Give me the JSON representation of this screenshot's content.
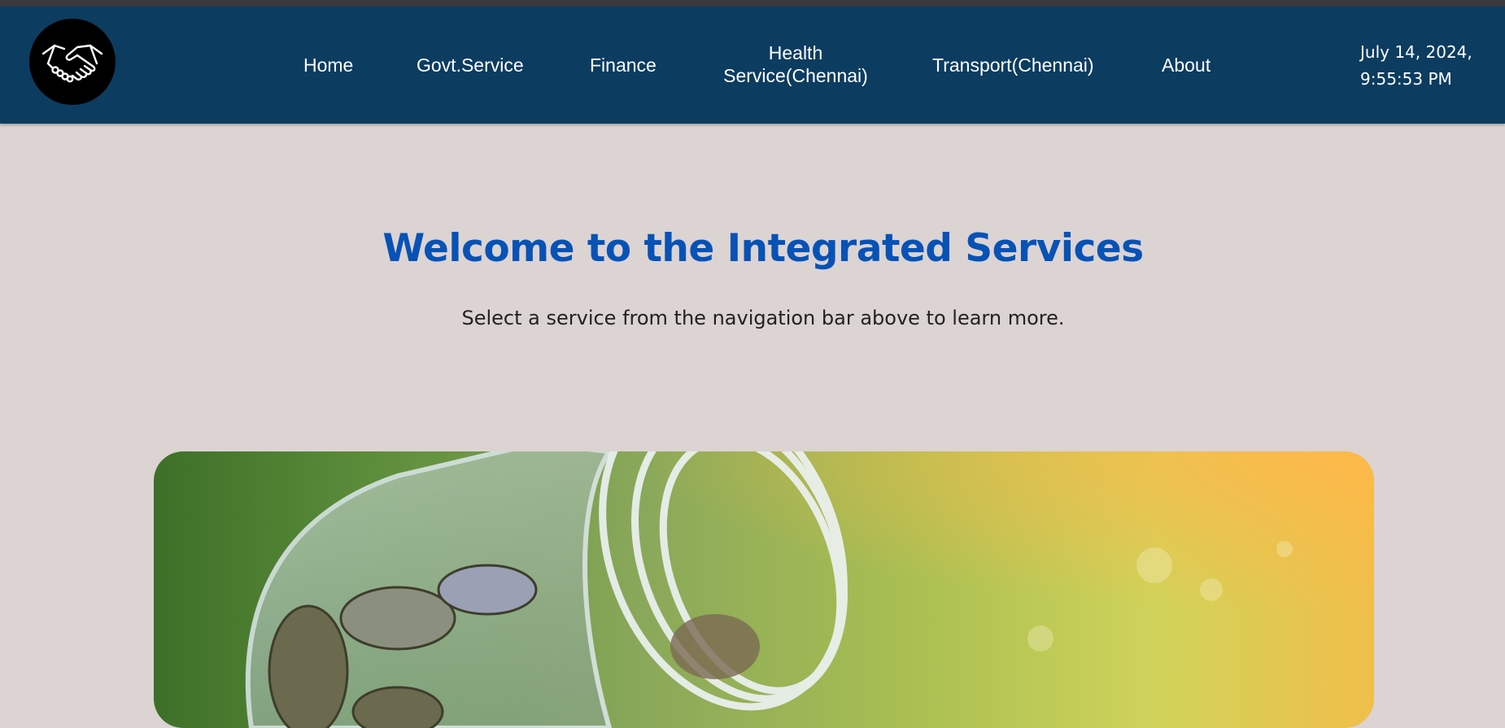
{
  "navbar": {
    "logo_icon": "handshake-icon",
    "links": [
      {
        "label": "Home"
      },
      {
        "label": "Govt.Service"
      },
      {
        "label": "Finance"
      },
      {
        "label": "Health Service(Chennai)"
      },
      {
        "label": "Transport(Chennai)"
      },
      {
        "label": "About"
      }
    ],
    "date": "July 14, 2024,",
    "time": "9:55:53 PM"
  },
  "hero": {
    "title": "Welcome to the Integrated Services",
    "subtitle": "Select a service from the navigation bar above to learn more.",
    "image_subject": "glass jar of coins on grass"
  },
  "colors": {
    "navbar_bg": "#0c3c60",
    "page_bg": "#dcd3d3",
    "title_blue": "#0752b6"
  }
}
